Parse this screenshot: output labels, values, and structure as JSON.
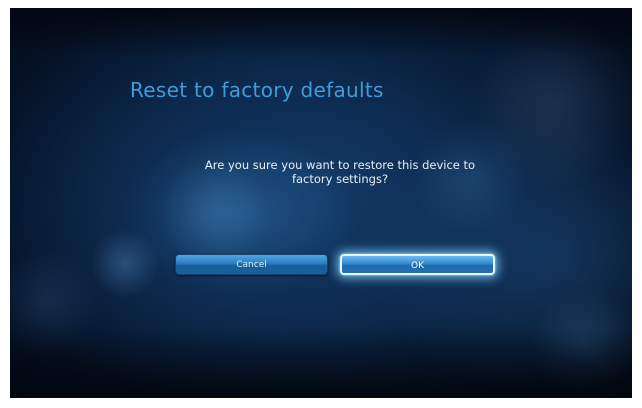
{
  "dialog": {
    "title": "Reset to factory defaults",
    "message_line1": "Are you sure you want to restore this device to",
    "message_line2": "factory settings?",
    "buttons": {
      "cancel_label": "Cancel",
      "ok_label": "OK"
    },
    "focused_button": "OK"
  },
  "colors": {
    "title": "#3f9cd8",
    "button_fill": "#2b7dc0",
    "focus_glow": "#78c8ff",
    "background": "#0a2444"
  }
}
